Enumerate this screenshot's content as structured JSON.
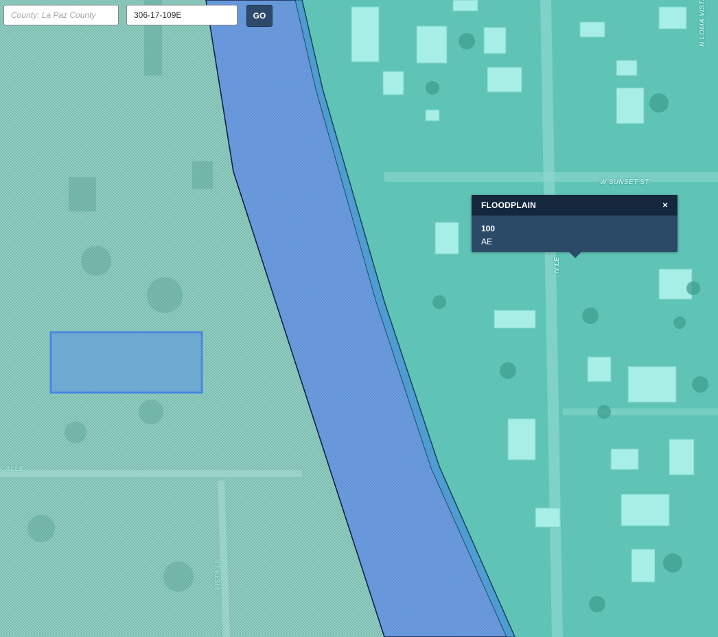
{
  "search": {
    "county_placeholder": "County: La Paz County",
    "parcel_value": "306-17-109E",
    "go_label": "GO"
  },
  "map": {
    "street_labels": {
      "loma_vista": "N LOMA VISTA",
      "sunset": "W SUNSET ST",
      "n_street": "N LE",
      "west_street": "CALLE",
      "bottom_street": "VISTA LN"
    },
    "colors": {
      "imagery_tint": "#5fc4b6",
      "floodplain_fill": "#4f8fd8",
      "floodplain_outline": "#0d2341",
      "selected_parcel": "#5a93e6"
    }
  },
  "popup": {
    "title": "FLOODPLAIN",
    "close_symbol": "×",
    "line1": "100",
    "line2": "AE"
  }
}
